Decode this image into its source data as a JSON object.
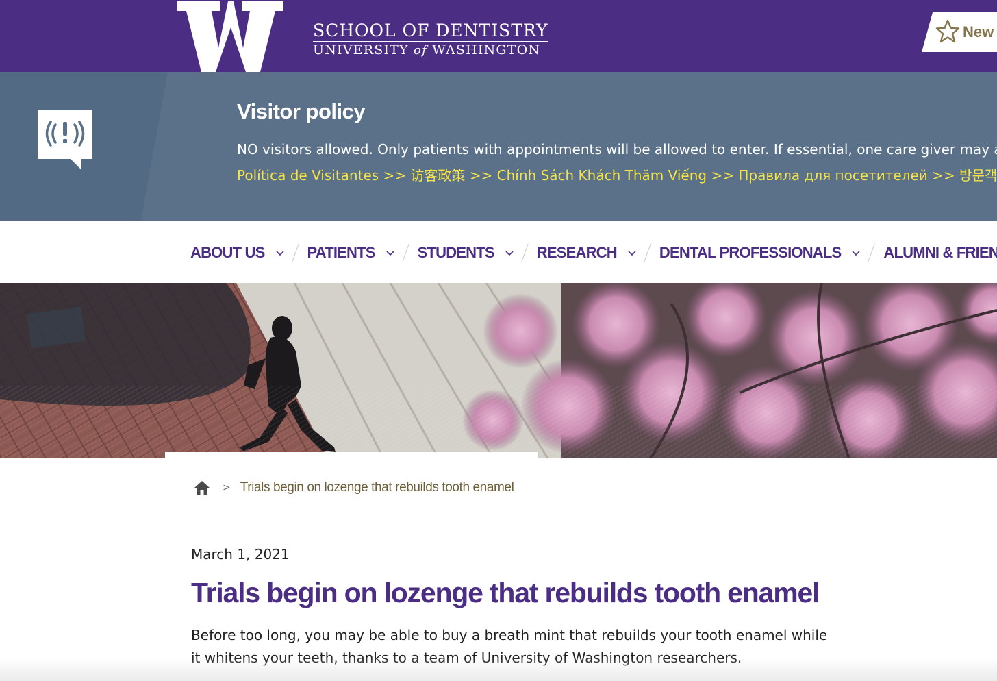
{
  "header": {
    "logo_letter": "W",
    "school_name": "SCHOOL OF DENTISTRY",
    "university_pre": "UNIVERSITY ",
    "university_of": "of",
    "university_post": " WASHINGTON",
    "corner_tab_label": "New P",
    "brand_color": "#4b2e83",
    "gold_color": "#85754d"
  },
  "alert": {
    "icon": "broadcast-alert-icon",
    "title": "Visitor policy",
    "message": "NO visitors allowed. Only patients with appointments will be allowed to enter. If essential, one care giver may accomp",
    "languages": [
      "Política de Visitantes >>",
      "访客政策 >>",
      "Chính Sách Khách Thăm Viếng >>",
      "Правила для посетителей >>",
      "방문객 규정 >>"
    ],
    "link_color": "#f5e348"
  },
  "nav": {
    "items": [
      "ABOUT US",
      "PATIENTS",
      "STUDENTS",
      "RESEARCH",
      "DENTAL PROFESSIONALS",
      "ALUMNI & FRIENDS"
    ]
  },
  "breadcrumb": {
    "home_icon": "home-icon",
    "separator": ">",
    "current": "Trials begin on lozenge that rebuilds tooth enamel"
  },
  "article": {
    "date": "March 1, 2021",
    "title": "Trials begin on lozenge that rebuilds tooth enamel",
    "lede": "Before too long, you may be able to buy a breath mint that rebuilds your tooth enamel while it whitens your teeth, thanks to a team of University of Washington researchers."
  }
}
